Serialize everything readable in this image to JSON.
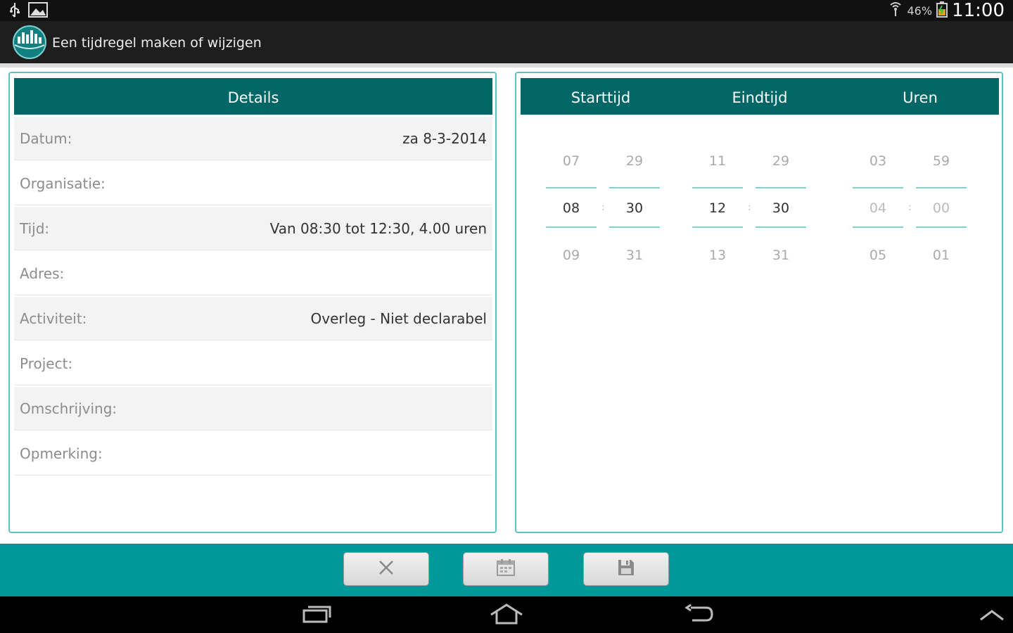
{
  "status_bar": {
    "battery_percent": "46%",
    "clock": "11:00",
    "icons": [
      "usb-icon",
      "image-icon",
      "wifi-icon",
      "battery-icon"
    ]
  },
  "action_bar": {
    "title": "Een tijdregel maken of wijzigen",
    "logo": "app-logo-icon"
  },
  "details": {
    "header": "Details",
    "rows": [
      {
        "label": "Datum:",
        "value": "za 8-3-2014"
      },
      {
        "label": "Organisatie:",
        "value": ""
      },
      {
        "label": "Tijd:",
        "value": "Van 08:30 tot 12:30, 4.00 uren"
      },
      {
        "label": "Adres:",
        "value": ""
      },
      {
        "label": "Activiteit:",
        "value": "Overleg - Niet declarabel"
      },
      {
        "label": "Project:",
        "value": ""
      },
      {
        "label": "Omschrijving:",
        "value": ""
      },
      {
        "label": "Opmerking:",
        "value": ""
      }
    ]
  },
  "time_panel": {
    "headers": {
      "start": "Starttijd",
      "end": "Eindtijd",
      "hours": "Uren"
    },
    "separator": ":",
    "start_hour": {
      "prev": "07",
      "current": "08",
      "next": "09"
    },
    "start_minute": {
      "prev": "29",
      "current": "30",
      "next": "31"
    },
    "end_hour": {
      "prev": "11",
      "current": "12",
      "next": "13"
    },
    "end_minute": {
      "prev": "29",
      "current": "30",
      "next": "31"
    },
    "hours_hour": {
      "prev": "03",
      "current": "04",
      "next": "05"
    },
    "hours_minute": {
      "prev": "59",
      "current": "00",
      "next": "01"
    }
  },
  "toolbar": {
    "buttons": [
      "close-icon",
      "calendar-icon",
      "save-icon"
    ]
  },
  "nav_bar": {
    "buttons": [
      "recent-apps-icon",
      "home-icon",
      "back-icon",
      "chevron-up-icon"
    ]
  },
  "colors": {
    "header_teal": "#006666",
    "toolbar_teal": "#009999",
    "panel_border": "#5fc1c1"
  }
}
